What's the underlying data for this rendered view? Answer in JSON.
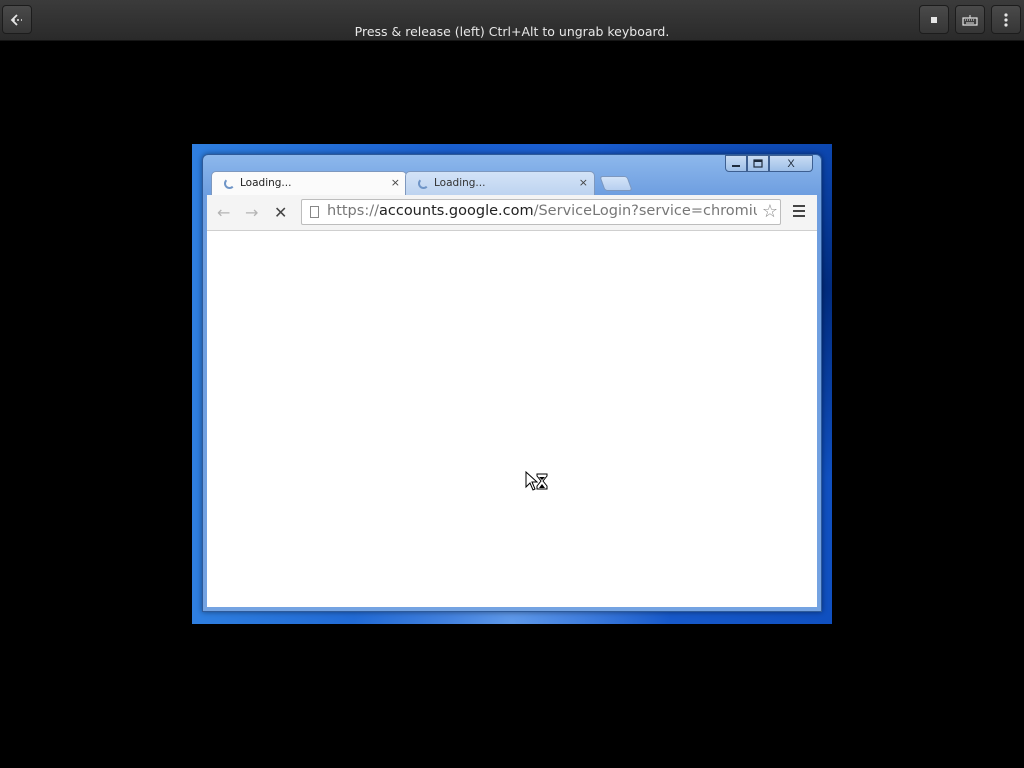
{
  "vm_bar": {
    "back_icon": "back-arrow-icon",
    "message": "Press & release (left) Ctrl+Alt to ungrab keyboard.",
    "actions": [
      "stop-icon",
      "keyboard-icon",
      "more-vertical-icon"
    ]
  },
  "window_controls": {
    "minimize": "—",
    "maximize": "□",
    "close": "X"
  },
  "tabs": [
    {
      "label": "Loading...",
      "close": "×",
      "active": true
    },
    {
      "label": "Loading...",
      "close": "×",
      "active": false
    }
  ],
  "toolbar": {
    "back": "←",
    "forward": "→",
    "stop": "✕",
    "url_scheme": "https://",
    "url_host": "accounts.google.com",
    "url_path": "/ServiceLogin?service=chromiur",
    "star": "☆"
  },
  "colors": {
    "vm_bar_bg": "#333333",
    "desktop_blue": "#1a5fcf",
    "window_frame": "#7aa5e2"
  }
}
